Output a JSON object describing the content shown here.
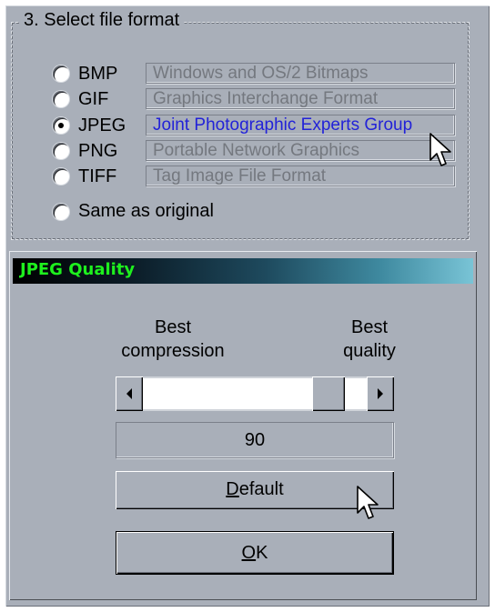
{
  "group": {
    "title": "3. Select file format"
  },
  "formats": [
    {
      "code": "BMP",
      "description": "Windows and OS/2 Bitmaps",
      "checked": false
    },
    {
      "code": "GIF",
      "description": "Graphics Interchange Format",
      "checked": false
    },
    {
      "code": "JPEG",
      "description": "Joint Photographic Experts Group",
      "checked": true
    },
    {
      "code": "PNG",
      "description": "Portable Network Graphics",
      "checked": false
    },
    {
      "code": "TIFF",
      "description": "Tag Image File Format",
      "checked": false
    }
  ],
  "same_as_original": {
    "label": "Same as original",
    "checked": false
  },
  "quality": {
    "title": "JPEG Quality",
    "left_label_line1": "Best",
    "left_label_line2": "compression",
    "right_label_line1": "Best",
    "right_label_line2": "quality",
    "value": "90",
    "default_button": {
      "mnemonic": "D",
      "rest": "efault"
    },
    "ok_button": {
      "mnemonic": "O",
      "rest": "K"
    }
  },
  "colors": {
    "panel": "#a9afb9",
    "selected_text": "#2222d8",
    "disabled_text": "#74787f",
    "title_text": "#1ef01e"
  },
  "icons": [
    "radio-button",
    "scroll-left-arrow-icon",
    "scroll-right-arrow-icon",
    "mouse-pointer-icon"
  ]
}
